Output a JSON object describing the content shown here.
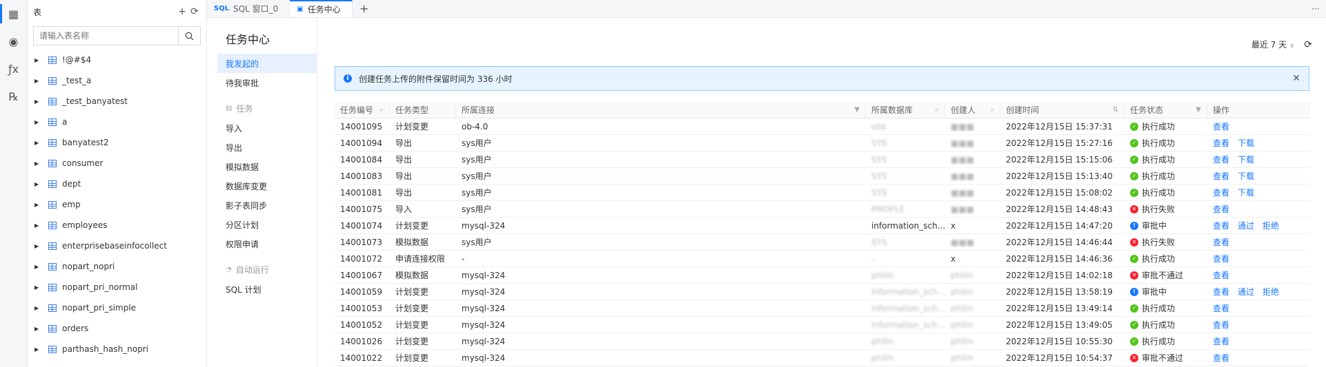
{
  "activity": [
    {
      "name": "table-icon",
      "glyph": "▦"
    },
    {
      "name": "eye-icon",
      "glyph": "◉"
    },
    {
      "name": "function-icon",
      "glyph": "ƒx"
    },
    {
      "name": "procedure-icon",
      "glyph": "℞"
    }
  ],
  "explorer": {
    "title": "表",
    "search_placeholder": "请输入表名称",
    "tables": [
      "!@#$4",
      "_test_a",
      "_test_banyatest",
      "a",
      "banyatest2",
      "consumer",
      "dept",
      "emp",
      "employees",
      "enterprisebaseinfocollect",
      "nopart_nopri",
      "nopart_pri_normal",
      "nopart_pri_simple",
      "orders",
      "parthash_hash_nopri"
    ]
  },
  "tabs": [
    {
      "icon": "SQL",
      "label": "SQL 窗口_0",
      "active": false
    },
    {
      "icon": "▣",
      "label": "任务中心",
      "active": true
    }
  ],
  "tasknav": {
    "title": "任务中心",
    "top_items": [
      "我发起的",
      "待我审批"
    ],
    "group1": "任务",
    "task_items": [
      "导入",
      "导出",
      "模拟数据",
      "数据库变更",
      "影子表同步",
      "分区计划",
      "权限申请"
    ],
    "group2": "自动运行",
    "auto_items": [
      "SQL 计划"
    ]
  },
  "toolbar": {
    "range_label": "最近 7 天"
  },
  "notice": {
    "text": "创建任务上传的附件保留时间为 336 小时"
  },
  "columns": [
    "任务编号",
    "任务类型",
    "所属连接",
    "所属数据库",
    "创建人",
    "创建时间",
    "任务状态",
    "操作"
  ],
  "rows": [
    {
      "id": "14001095",
      "type": "计划变更",
      "conn": "ob-4.0",
      "db": "obs",
      "creator": "■■■",
      "time": "2022年12月15日 15:37:31",
      "status": "执行成功",
      "state": "ok",
      "actions": [
        "查看"
      ]
    },
    {
      "id": "14001094",
      "type": "导出",
      "conn": "sys用户",
      "db": "SYS",
      "creator": "■■■",
      "time": "2022年12月15日 15:27:16",
      "status": "执行成功",
      "state": "ok",
      "actions": [
        "查看",
        "下载"
      ]
    },
    {
      "id": "14001084",
      "type": "导出",
      "conn": "sys用户",
      "db": "SYS",
      "creator": "■■■",
      "time": "2022年12月15日 15:15:06",
      "status": "执行成功",
      "state": "ok",
      "actions": [
        "查看",
        "下载"
      ]
    },
    {
      "id": "14001083",
      "type": "导出",
      "conn": "sys用户",
      "db": "SYS",
      "creator": "■■■",
      "time": "2022年12月15日 15:13:40",
      "status": "执行成功",
      "state": "ok",
      "actions": [
        "查看",
        "下载"
      ]
    },
    {
      "id": "14001081",
      "type": "导出",
      "conn": "sys用户",
      "db": "SYS",
      "creator": "■■■",
      "time": "2022年12月15日 15:08:02",
      "status": "执行成功",
      "state": "ok",
      "actions": [
        "查看",
        "下载"
      ]
    },
    {
      "id": "14001075",
      "type": "导入",
      "conn": "sys用户",
      "db": "PMOFLE",
      "creator": "■■■",
      "time": "2022年12月15日 14:48:43",
      "status": "执行失败",
      "state": "fail",
      "actions": [
        "查看"
      ]
    },
    {
      "id": "14001074",
      "type": "计划变更",
      "conn": "mysql-324",
      "db": "information_sch...",
      "creator": "x",
      "time": "2022年12月15日 14:47:20",
      "status": "审批中",
      "state": "wait",
      "actions": [
        "查看",
        "通过",
        "拒绝"
      ]
    },
    {
      "id": "14001073",
      "type": "模拟数据",
      "conn": "sys用户",
      "db": "SYS",
      "creator": "■■■",
      "time": "2022年12月15日 14:46:44",
      "status": "执行失败",
      "state": "fail",
      "actions": [
        "查看"
      ]
    },
    {
      "id": "14001072",
      "type": "申请连接权限",
      "conn": "-",
      "db": "-",
      "creator": "x",
      "time": "2022年12月15日 14:46:36",
      "status": "执行成功",
      "state": "ok",
      "actions": [
        "查看"
      ]
    },
    {
      "id": "14001067",
      "type": "模拟数据",
      "conn": "mysql-324",
      "db": "philin",
      "creator": "philin",
      "time": "2022年12月15日 14:02:18",
      "status": "审批不通过",
      "state": "fail",
      "actions": [
        "查看"
      ]
    },
    {
      "id": "14001059",
      "type": "计划变更",
      "conn": "mysql-324",
      "db": "information_sch...",
      "creator": "philin",
      "time": "2022年12月15日 13:58:19",
      "status": "审批中",
      "state": "wait",
      "actions": [
        "查看",
        "通过",
        "拒绝"
      ]
    },
    {
      "id": "14001053",
      "type": "计划变更",
      "conn": "mysql-324",
      "db": "information_sch...",
      "creator": "philin",
      "time": "2022年12月15日 13:49:14",
      "status": "执行成功",
      "state": "ok",
      "actions": [
        "查看"
      ]
    },
    {
      "id": "14001052",
      "type": "计划变更",
      "conn": "mysql-324",
      "db": "information_sch...",
      "creator": "philin",
      "time": "2022年12月15日 13:49:05",
      "status": "执行成功",
      "state": "ok",
      "actions": [
        "查看"
      ]
    },
    {
      "id": "14001026",
      "type": "计划变更",
      "conn": "mysql-324",
      "db": "philin",
      "creator": "philin",
      "time": "2022年12月15日 10:55:30",
      "status": "执行成功",
      "state": "ok",
      "actions": [
        "查看"
      ]
    },
    {
      "id": "14001022",
      "type": "计划变更",
      "conn": "mysql-324",
      "db": "philin",
      "creator": "philin",
      "time": "2022年12月15日 10:54:37",
      "status": "审批不通过",
      "state": "fail",
      "actions": [
        "查看"
      ]
    }
  ]
}
